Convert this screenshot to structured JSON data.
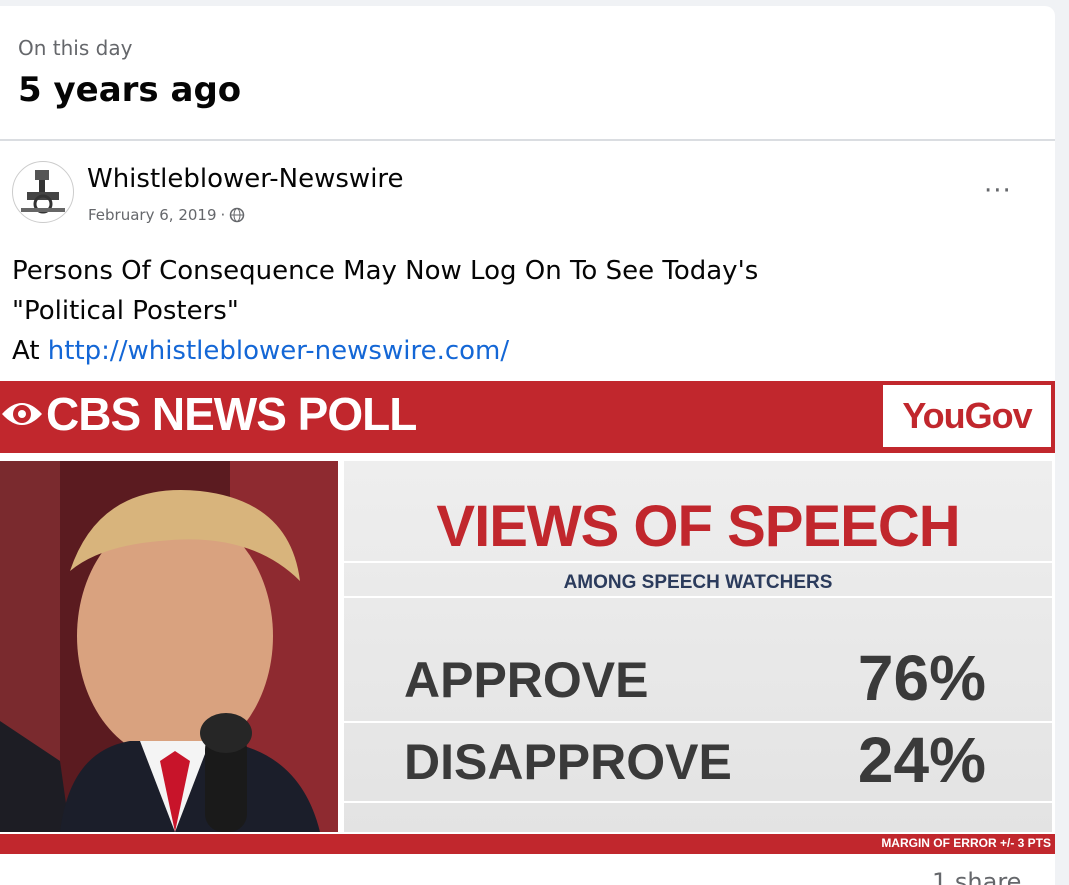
{
  "memory": {
    "label": "On this day",
    "title": "5 years ago"
  },
  "post": {
    "author": "Whistleblower-Newswire",
    "date": "February 6, 2019",
    "separator": "·",
    "audience_icon": "globe-icon",
    "more_label": "···",
    "text_line1": "Persons Of Consequence May Now Log On To See Today's",
    "text_line2": "\"Political Posters\"",
    "text_prefix": "At ",
    "link": "http://whistleblower-newswire.com/"
  },
  "poster": {
    "brand": "CBS NEWS POLL",
    "partner": "YouGov",
    "title": "VIEWS OF SPEECH",
    "subtitle": "AMONG SPEECH WATCHERS",
    "rows": [
      {
        "label": "APPROVE",
        "value": "76%"
      },
      {
        "label": "DISAPPROVE",
        "value": "24%"
      }
    ],
    "margin_note": "MARGIN OF ERROR +/- 3 PTS"
  },
  "footer": {
    "shares": "1 share"
  },
  "colors": {
    "cbs_red": "#c1272d",
    "link_blue": "#1467d6",
    "muted_gray": "#65676b"
  }
}
